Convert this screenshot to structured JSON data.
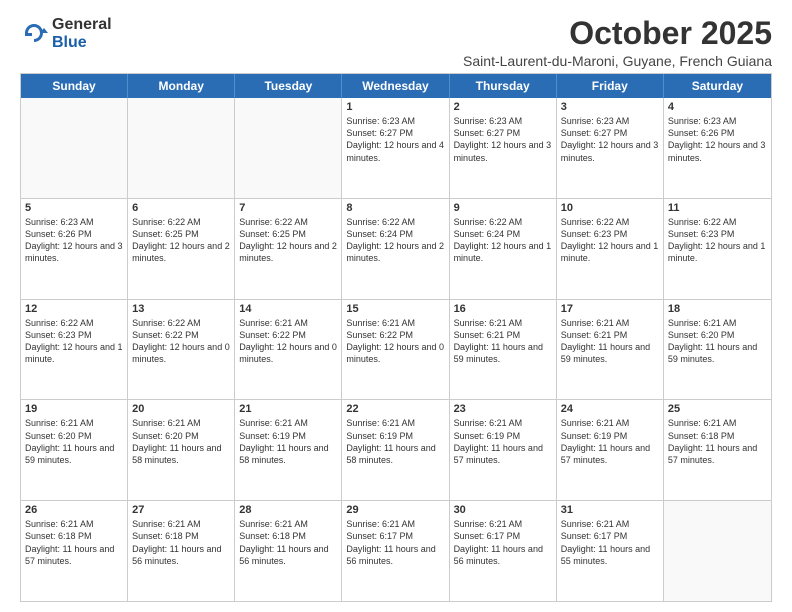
{
  "logo": {
    "general": "General",
    "blue": "Blue"
  },
  "header": {
    "month": "October 2025",
    "subtitle": "Saint-Laurent-du-Maroni, Guyane, French Guiana"
  },
  "days": [
    "Sunday",
    "Monday",
    "Tuesday",
    "Wednesday",
    "Thursday",
    "Friday",
    "Saturday"
  ],
  "weeks": [
    [
      {
        "day": "",
        "empty": true
      },
      {
        "day": "",
        "empty": true
      },
      {
        "day": "",
        "empty": true
      },
      {
        "day": "1",
        "sunrise": "6:23 AM",
        "sunset": "6:27 PM",
        "daylight": "12 hours and 4 minutes."
      },
      {
        "day": "2",
        "sunrise": "6:23 AM",
        "sunset": "6:27 PM",
        "daylight": "12 hours and 3 minutes."
      },
      {
        "day": "3",
        "sunrise": "6:23 AM",
        "sunset": "6:27 PM",
        "daylight": "12 hours and 3 minutes."
      },
      {
        "day": "4",
        "sunrise": "6:23 AM",
        "sunset": "6:26 PM",
        "daylight": "12 hours and 3 minutes."
      }
    ],
    [
      {
        "day": "5",
        "sunrise": "6:23 AM",
        "sunset": "6:26 PM",
        "daylight": "12 hours and 3 minutes."
      },
      {
        "day": "6",
        "sunrise": "6:22 AM",
        "sunset": "6:25 PM",
        "daylight": "12 hours and 2 minutes."
      },
      {
        "day": "7",
        "sunrise": "6:22 AM",
        "sunset": "6:25 PM",
        "daylight": "12 hours and 2 minutes."
      },
      {
        "day": "8",
        "sunrise": "6:22 AM",
        "sunset": "6:24 PM",
        "daylight": "12 hours and 2 minutes."
      },
      {
        "day": "9",
        "sunrise": "6:22 AM",
        "sunset": "6:24 PM",
        "daylight": "12 hours and 1 minute."
      },
      {
        "day": "10",
        "sunrise": "6:22 AM",
        "sunset": "6:23 PM",
        "daylight": "12 hours and 1 minute."
      },
      {
        "day": "11",
        "sunrise": "6:22 AM",
        "sunset": "6:23 PM",
        "daylight": "12 hours and 1 minute."
      }
    ],
    [
      {
        "day": "12",
        "sunrise": "6:22 AM",
        "sunset": "6:23 PM",
        "daylight": "12 hours and 1 minute."
      },
      {
        "day": "13",
        "sunrise": "6:22 AM",
        "sunset": "6:22 PM",
        "daylight": "12 hours and 0 minutes."
      },
      {
        "day": "14",
        "sunrise": "6:21 AM",
        "sunset": "6:22 PM",
        "daylight": "12 hours and 0 minutes."
      },
      {
        "day": "15",
        "sunrise": "6:21 AM",
        "sunset": "6:22 PM",
        "daylight": "12 hours and 0 minutes."
      },
      {
        "day": "16",
        "sunrise": "6:21 AM",
        "sunset": "6:21 PM",
        "daylight": "11 hours and 59 minutes."
      },
      {
        "day": "17",
        "sunrise": "6:21 AM",
        "sunset": "6:21 PM",
        "daylight": "11 hours and 59 minutes."
      },
      {
        "day": "18",
        "sunrise": "6:21 AM",
        "sunset": "6:20 PM",
        "daylight": "11 hours and 59 minutes."
      }
    ],
    [
      {
        "day": "19",
        "sunrise": "6:21 AM",
        "sunset": "6:20 PM",
        "daylight": "11 hours and 59 minutes."
      },
      {
        "day": "20",
        "sunrise": "6:21 AM",
        "sunset": "6:20 PM",
        "daylight": "11 hours and 58 minutes."
      },
      {
        "day": "21",
        "sunrise": "6:21 AM",
        "sunset": "6:19 PM",
        "daylight": "11 hours and 58 minutes."
      },
      {
        "day": "22",
        "sunrise": "6:21 AM",
        "sunset": "6:19 PM",
        "daylight": "11 hours and 58 minutes."
      },
      {
        "day": "23",
        "sunrise": "6:21 AM",
        "sunset": "6:19 PM",
        "daylight": "11 hours and 57 minutes."
      },
      {
        "day": "24",
        "sunrise": "6:21 AM",
        "sunset": "6:19 PM",
        "daylight": "11 hours and 57 minutes."
      },
      {
        "day": "25",
        "sunrise": "6:21 AM",
        "sunset": "6:18 PM",
        "daylight": "11 hours and 57 minutes."
      }
    ],
    [
      {
        "day": "26",
        "sunrise": "6:21 AM",
        "sunset": "6:18 PM",
        "daylight": "11 hours and 57 minutes."
      },
      {
        "day": "27",
        "sunrise": "6:21 AM",
        "sunset": "6:18 PM",
        "daylight": "11 hours and 56 minutes."
      },
      {
        "day": "28",
        "sunrise": "6:21 AM",
        "sunset": "6:18 PM",
        "daylight": "11 hours and 56 minutes."
      },
      {
        "day": "29",
        "sunrise": "6:21 AM",
        "sunset": "6:17 PM",
        "daylight": "11 hours and 56 minutes."
      },
      {
        "day": "30",
        "sunrise": "6:21 AM",
        "sunset": "6:17 PM",
        "daylight": "11 hours and 56 minutes."
      },
      {
        "day": "31",
        "sunrise": "6:21 AM",
        "sunset": "6:17 PM",
        "daylight": "11 hours and 55 minutes."
      },
      {
        "day": "",
        "empty": true
      }
    ]
  ]
}
